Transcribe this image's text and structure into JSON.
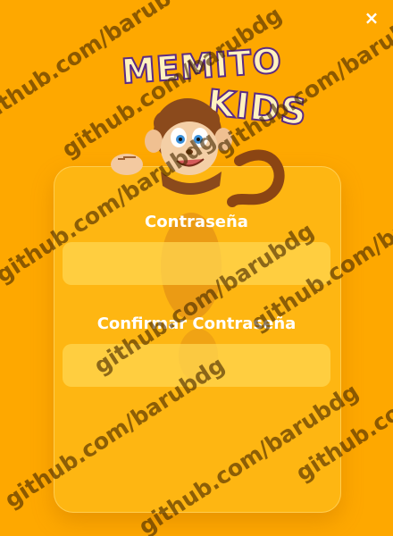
{
  "window": {
    "close_symbol": "×"
  },
  "logo": {
    "line1": "MEMITO",
    "line2": "KIDS"
  },
  "form": {
    "password_label": "Contraseña",
    "password_value": "",
    "confirm_label": "Confirmar Contraseña",
    "confirm_value": ""
  },
  "watermark": {
    "text": "github.com/barubdg"
  },
  "colors": {
    "background": "#fea800",
    "card": "#ffc828",
    "input": "#ffd650",
    "logo_outline": "#5a2a86",
    "logo_fill": "#fff3c0"
  },
  "icons": {
    "close": "close-icon",
    "mascot": "monkey-mascot"
  }
}
